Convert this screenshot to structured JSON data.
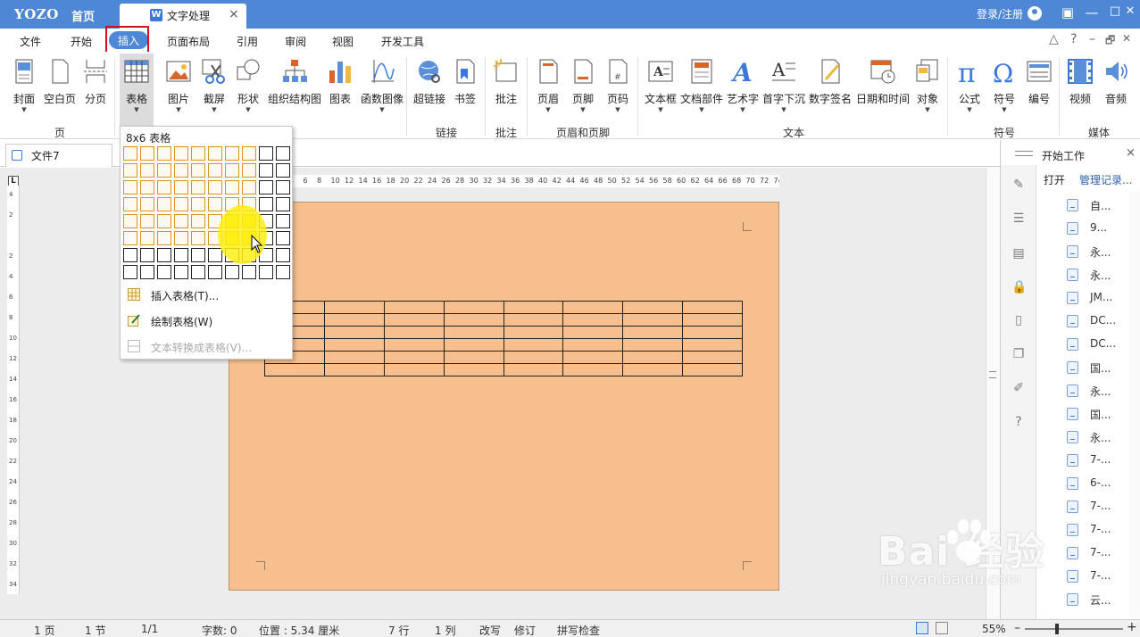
{
  "titlebar": {
    "logo": "YOZO",
    "home": "首页",
    "doc_tab": "文字处理",
    "doc_icon": "W",
    "close": "×",
    "login": "登录/注册",
    "win_buttons": [
      "▣",
      "—",
      "□",
      "✕"
    ]
  },
  "menu": {
    "items": [
      "文件",
      "开始",
      "插入",
      "页面布局",
      "引用",
      "审阅",
      "视图",
      "开发工具"
    ],
    "active": "插入",
    "right": [
      "△",
      "?",
      "–",
      "🗗",
      "✕"
    ]
  },
  "ribbon": {
    "buttons": [
      "封面",
      "空白页",
      "分页",
      "表格",
      "图片",
      "截屏",
      "形状",
      "组织结构图",
      "图表",
      "函数图像",
      "超链接",
      "书签",
      "批注",
      "页眉",
      "页脚",
      "页码",
      "文本框",
      "文档部件",
      "艺术字",
      "首字下沉",
      "数字签名",
      "日期和时间",
      "对象",
      "公式",
      "符号",
      "编号",
      "视频",
      "音频"
    ],
    "groups": [
      "页",
      "链接",
      "批注",
      "页眉和页脚",
      "文本",
      "符号",
      "媒体"
    ]
  },
  "doc_tab": {
    "name": "文件7"
  },
  "ruler": {
    "corner": "L",
    "h_ticks": [
      "4",
      "6",
      "8",
      "10",
      "12",
      "14",
      "16",
      "18",
      "20",
      "22",
      "24",
      "26",
      "28",
      "30",
      "32",
      "34",
      "36",
      "38",
      "40",
      "42",
      "44",
      "46",
      "48",
      "50",
      "52",
      "54",
      "56",
      "58",
      "60",
      "62",
      "64",
      "66",
      "68",
      "70",
      "72",
      "74"
    ],
    "v_ticks": [
      "4",
      "2",
      "",
      "2",
      "4",
      "6",
      "8",
      "10",
      "12",
      "14",
      "16",
      "18",
      "20",
      "22",
      "24",
      "26",
      "28",
      "30",
      "32",
      "34"
    ]
  },
  "table_menu": {
    "title": "8x6 表格",
    "insert": "插入表格(T)...",
    "draw": "绘制表格(W)",
    "convert": "文本转换成表格(V)..."
  },
  "right_panel": {
    "title": "开始工作",
    "close": "×",
    "open": "打开",
    "manage": "管理记录...",
    "recent": [
      "自...",
      "9...",
      "永...",
      "永...",
      "JM...",
      "DC...",
      "DC...",
      "国...",
      "永...",
      "国...",
      "永...",
      "7-...",
      "6-...",
      "7-...",
      "7-...",
      "7-...",
      "7-...",
      "云..."
    ]
  },
  "statusbar": {
    "page": "1 页",
    "section": "1 节",
    "pages": "1/1",
    "words": "字数: 0",
    "position": "位置 : 5.34 厘米",
    "row": "7 行",
    "col": "1 列",
    "overwrite": "改写",
    "revise": "修订",
    "spell": "拼写检查",
    "zoom": "55%",
    "minus": "–",
    "plus": "+"
  },
  "watermark": {
    "brand": "Bai  经验",
    "url": "jingyan.baidu.com"
  },
  "colors": {
    "titlebar": "#4e87d6",
    "page": "#f6bf8d",
    "highlight": "#fff21a",
    "cell_border": "#e0901c"
  }
}
